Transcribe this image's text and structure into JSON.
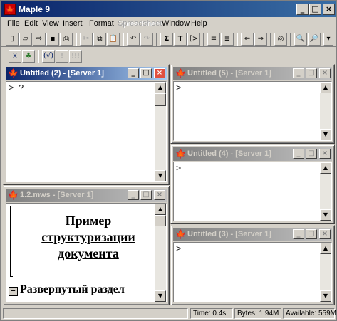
{
  "app": {
    "title": "Maple 9",
    "icon": "maple-icon"
  },
  "menu": [
    "File",
    "Edit",
    "View",
    "Insert",
    "Format",
    "Spreadsheet",
    "Window",
    "Help"
  ],
  "menu_disabled": [
    "Spreadsheet"
  ],
  "windows": {
    "w2": {
      "title": "Untitled (2) - [Server 1]",
      "prompt": "> ?"
    },
    "w5": {
      "title": "Untitled (5) - [Server 1]",
      "prompt": ">"
    },
    "w4": {
      "title": "Untitled (4) - [Server 1]",
      "prompt": ">"
    },
    "w3": {
      "title": "Untitled (3) - [Server 1]",
      "prompt": ">"
    },
    "w1": {
      "title": "1.2.mws - [Server 1]",
      "heading_lines": [
        "Пример",
        "структуризации",
        "документа"
      ],
      "section": "Развернутый раздел",
      "section_toggle": "−"
    }
  },
  "status": {
    "time": "Time:  0.4s",
    "bytes": "Bytes: 1.94M",
    "available": "Available: 559M"
  },
  "colors": {
    "title_active": "#0a246a",
    "title_gradient_end": "#a6caf0",
    "face": "#d4d0c8"
  }
}
